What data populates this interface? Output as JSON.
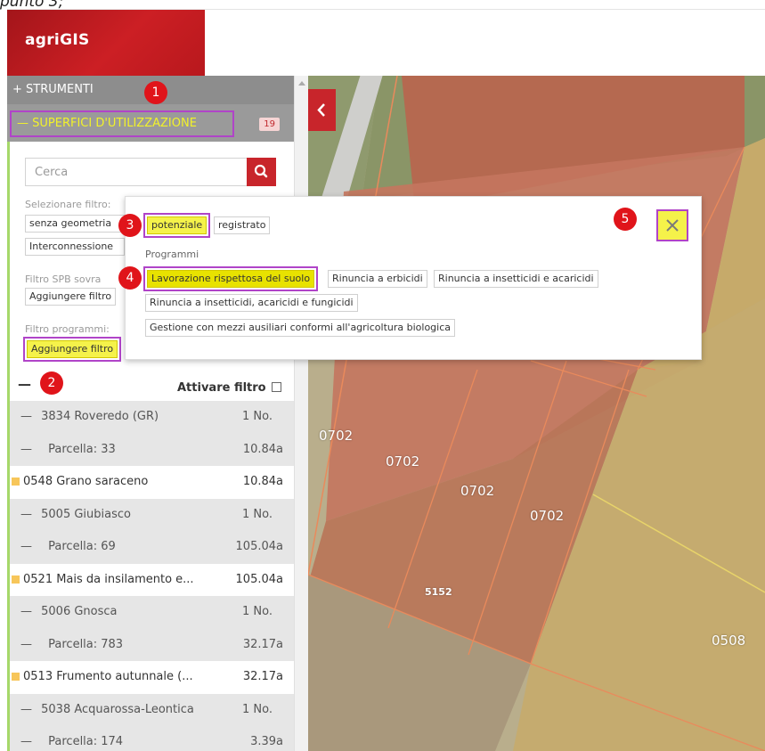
{
  "caption": "punto 3;",
  "app": {
    "brand_prefix": "agri",
    "brand_suffix": "GIS"
  },
  "sidebar": {
    "strumenti": "+ STRUMENTI",
    "superfici": "— SUPERFICI D'UTILIZZAZIONE",
    "superfici_count": "19",
    "search_placeholder": "Cerca",
    "filter_label": "Selezionare filtro:",
    "chip_senza": "senza geometria",
    "chip_interconnessione": "Interconnessione",
    "spb_label": "Filtro SPB sovra",
    "spb_add": "Aggiungere filtro",
    "programs_label": "Filtro programmi:",
    "programs_add": "Aggiungere filtro",
    "collapse_dash": "—",
    "activate_filter": "Attivare filtro"
  },
  "tree": [
    {
      "kind": "g",
      "indent": 18,
      "label": "3834 Roveredo (GR)",
      "dash": true,
      "value": "1 No."
    },
    {
      "kind": "g",
      "indent": 18,
      "label": "Parcella: 33",
      "dash": true,
      "sub": true,
      "value": "10.84a"
    },
    {
      "kind": "w",
      "indent": 2,
      "label": "0548 Grano saraceno",
      "square": true,
      "value": "10.84a"
    },
    {
      "kind": "g",
      "indent": 18,
      "label": "5005 Giubiasco",
      "dash": true,
      "value": "1 No."
    },
    {
      "kind": "g",
      "indent": 18,
      "label": "Parcella: 69",
      "dash": true,
      "sub": true,
      "value": "105.04a"
    },
    {
      "kind": "w",
      "indent": 2,
      "label": "0521 Mais da insilamento e...",
      "square": true,
      "value": "105.04a"
    },
    {
      "kind": "g",
      "indent": 18,
      "label": "5006 Gnosca",
      "dash": true,
      "value": "1 No."
    },
    {
      "kind": "g",
      "indent": 18,
      "label": "Parcella: 783",
      "dash": true,
      "sub": true,
      "value": "32.17a"
    },
    {
      "kind": "w",
      "indent": 2,
      "label": "0513 Frumento autunnale (...",
      "square": true,
      "value": "32.17a"
    },
    {
      "kind": "g",
      "indent": 18,
      "label": "5038 Acquarossa-Leontica",
      "dash": true,
      "value": "1 No."
    },
    {
      "kind": "g",
      "indent": 18,
      "label": "Parcella: 174",
      "dash": true,
      "sub": true,
      "value": "3.39a"
    }
  ],
  "popup": {
    "state_potenziale": "potenziale",
    "state_registrato": "registrato",
    "programs_heading": "Programmi",
    "programs": [
      "Lavorazione rispettosa del suolo",
      "Rinuncia a erbicidi",
      "Rinuncia a insetticidi e acaricidi",
      "Rinuncia a insetticidi, acaricidi e fungicidi",
      "Gestione con mezzi ausiliari conformi all'agricoltura biologica"
    ],
    "close_symbol": "✕"
  },
  "markers": [
    "1",
    "2",
    "3",
    "4",
    "5"
  ],
  "map_labels": [
    "0702",
    "0702",
    "0702",
    "0702",
    "5152",
    "0508"
  ],
  "colors": {
    "brand_red": "#c8252b",
    "highlight_yellow": "#f5f24a",
    "marker_outline": "#b044c8",
    "marker_red": "#e0141a"
  }
}
